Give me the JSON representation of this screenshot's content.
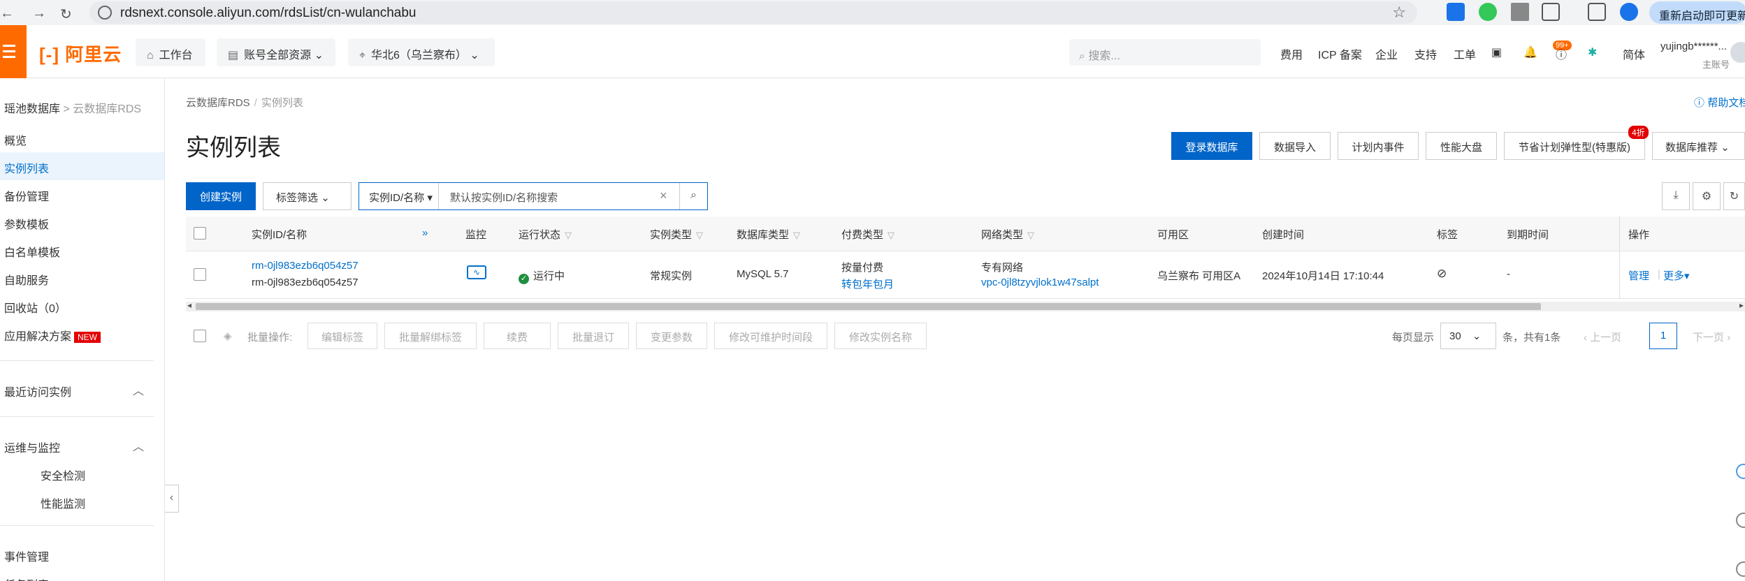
{
  "browser": {
    "url": "rdsnext.console.aliyun.com/rdsList/cn-wulanchabu",
    "update_button": "重新启动即可更新"
  },
  "topnav": {
    "logo": "阿里云",
    "workbench": "工作台",
    "account_resources": "账号全部资源",
    "region": "华北6（乌兰察布）",
    "search_placeholder": "搜索...",
    "links": [
      "费用",
      "ICP 备案",
      "企业",
      "支持",
      "工单"
    ],
    "notification_badge": "99+",
    "language": "简体",
    "user_name": "yujingb******...",
    "user_role": "主账号"
  },
  "sidebar": {
    "breadcrumb_parent": "瑶池数据库",
    "breadcrumb_sep": ">",
    "breadcrumb_current": "云数据库RDS",
    "items": [
      "概览",
      "实例列表",
      "备份管理",
      "参数模板",
      "白名单模板",
      "自助服务",
      "回收站（0）",
      "应用解决方案"
    ],
    "new_tag": "NEW",
    "recent_section": "最近访问实例",
    "ops_section": "运维与监控",
    "ops_items": [
      "安全检测",
      "性能监测"
    ],
    "event_management": "事件管理",
    "task_list": "任务列表"
  },
  "main": {
    "breadcrumb": [
      "云数据库RDS",
      "实例列表"
    ],
    "breadcrumb_sep": "/",
    "help": "帮助文档",
    "title": "实例列表",
    "header_buttons": [
      "登录数据库",
      "数据导入",
      "计划内事件",
      "性能大盘",
      "节省计划弹性型(特惠版)",
      "数据库推荐"
    ],
    "discount_badge": "4折",
    "create_instance": "创建实例",
    "tag_filter": "标签筛选",
    "filter_select": "实例ID/名称",
    "filter_input_placeholder": "默认按实例ID/名称搜索"
  },
  "table": {
    "headers": {
      "instance": "实例ID/名称",
      "monitor": "监控",
      "status": "运行状态",
      "instance_type": "实例类型",
      "db_type": "数据库类型",
      "payment": "付费类型",
      "network": "网络类型",
      "zone": "可用区",
      "created": "创建时间",
      "tags": "标签",
      "expire": "到期时间",
      "ops": "操作"
    },
    "rows": [
      {
        "instance_id": "rm-0jl983ezb6q054z57",
        "instance_name": "rm-0jl983ezb6q054z57",
        "status": "运行中",
        "instance_type": "常规实例",
        "db_type": "MySQL 5.7",
        "payment": "按量付费",
        "payment_link": "转包年包月",
        "network": "专有网络",
        "vpc": "vpc-0jl8tzyvjlok1w47salpt",
        "zone": "乌兰察布 可用区A",
        "created": "2024年10月14日 17:10:44",
        "expire": "-",
        "manage": "管理",
        "more": "更多"
      }
    ]
  },
  "batch": {
    "label": "批量操作:",
    "buttons": [
      "编辑标签",
      "批量解绑标签",
      "续费",
      "批量退订",
      "变更参数",
      "修改可维护时间段",
      "修改实例名称"
    ]
  },
  "pagination": {
    "per_page_label": "每页显示",
    "per_page": "30",
    "total": "条，共有1条",
    "prev": "上一页",
    "current": "1",
    "next": "下一页"
  }
}
